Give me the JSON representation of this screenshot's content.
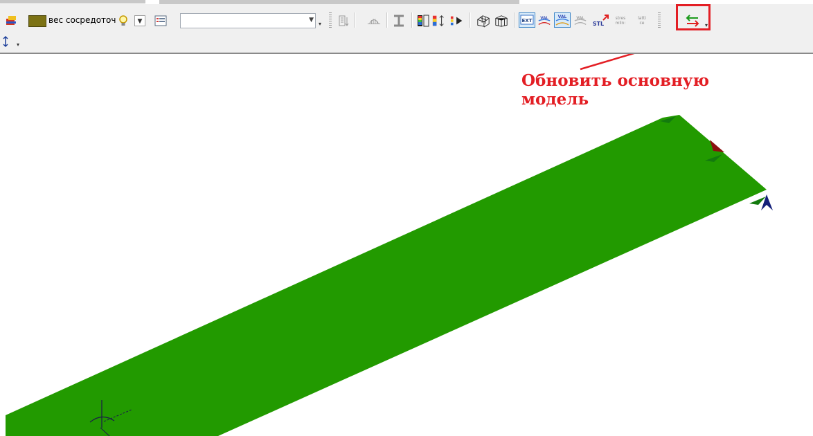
{
  "toolbar": {
    "load_case_label": "вес сосредоточ",
    "load_case_color": "#7c7214",
    "combo_value": "",
    "tools": [
      {
        "name": "model-icon"
      },
      {
        "name": "color-swatch"
      },
      {
        "name": "bulb-icon"
      },
      {
        "name": "list-icon"
      },
      {
        "name": "column-icon"
      },
      {
        "name": "supports-icon"
      },
      {
        "name": "section-icon"
      },
      {
        "name": "color-scale-icon"
      },
      {
        "name": "deformation-scale-icon"
      },
      {
        "name": "animation-icon"
      },
      {
        "name": "mesh-3d-icon"
      },
      {
        "name": "mesh-3d-alt-icon"
      },
      {
        "name": "ext-icon"
      },
      {
        "name": "val-icon"
      },
      {
        "name": "val-active-icon"
      },
      {
        "name": "val-disabled-icon"
      },
      {
        "name": "stl-icon"
      },
      {
        "name": "stress-icon"
      },
      {
        "name": "lattice-icon"
      },
      {
        "name": "update-model-icon"
      }
    ],
    "ext_text": "EXT",
    "val_text": "VAL",
    "stl_text": "STL",
    "stress_text_1": "stres",
    "stress_text_2": "mlin:",
    "lattice_text_1": "latti",
    "lattice_text_2": "ce"
  },
  "annotation": {
    "line1": "Обновить основную",
    "line2": "модель",
    "color": "#e31e24"
  },
  "model": {
    "beam_color": "#229a00",
    "arrow_green": "#137a0e",
    "arrow_red": "#8b1010",
    "arrow_blue": "#14207a"
  }
}
